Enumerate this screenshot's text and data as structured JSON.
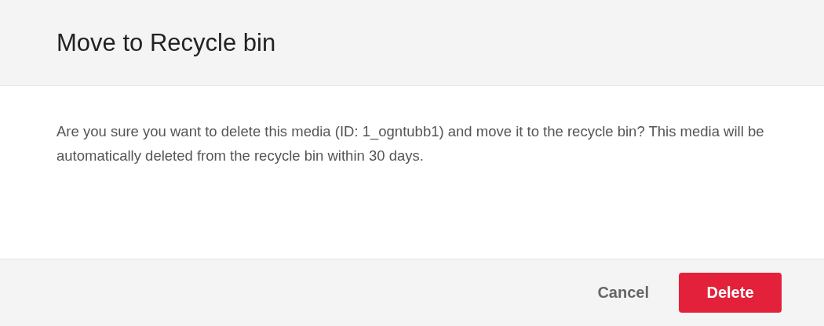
{
  "dialog": {
    "title": "Move to Recycle bin",
    "message": "Are you sure you want to delete this media (ID: 1_ogntubb1) and move it to the recycle bin? This media will be automatically deleted from the recycle bin within 30 days.",
    "buttons": [
      {
        "label": "Cancel",
        "kind": "secondary"
      },
      {
        "label": "Delete",
        "kind": "primary"
      }
    ]
  }
}
